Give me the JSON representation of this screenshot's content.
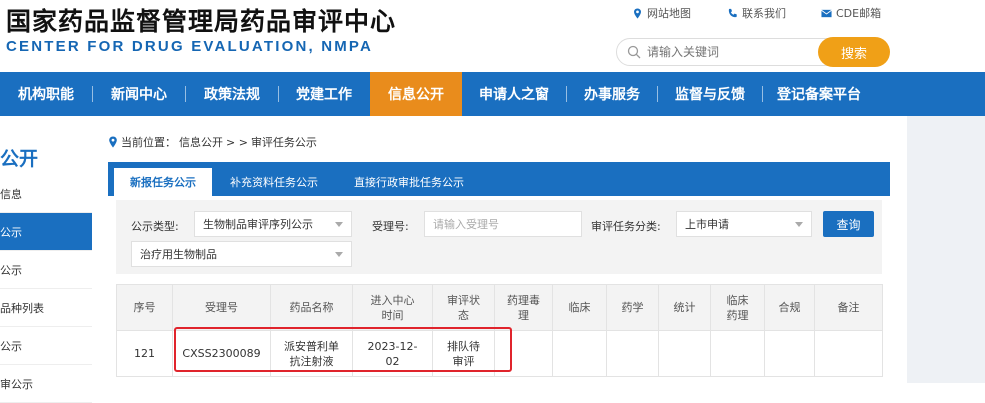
{
  "header": {
    "title_cn": "国家药品监督管理局药品审评中心",
    "title_en": "CENTER FOR DRUG EVALUATION, NMPA",
    "toplinks": [
      {
        "icon": "map-pin-icon",
        "label": "网站地图"
      },
      {
        "icon": "phone-icon",
        "label": "联系我们"
      },
      {
        "icon": "mail-icon",
        "label": "CDE邮箱"
      }
    ],
    "search_placeholder": "请输入关键词",
    "search_button": "搜索"
  },
  "nav": {
    "items": [
      "机构职能",
      "新闻中心",
      "政策法规",
      "党建工作",
      "信息公开",
      "申请人之窗",
      "办事服务",
      "监督与反馈",
      "登记备案平台"
    ],
    "active": "信息公开"
  },
  "sidebar": {
    "title": "公开",
    "items": [
      "信息",
      "公示",
      "公示",
      "品种列表",
      "公示",
      "审公示"
    ]
  },
  "breadcrumb": {
    "prefix": "当前位置：",
    "path1": "信息公开",
    "sep": "> >",
    "path2": "审评任务公示"
  },
  "tabs": [
    "新报任务公示",
    "补充资料任务公示",
    "直接行政审批任务公示"
  ],
  "filters": {
    "type_label": "公示类型:",
    "type_value": "生物制品审评序列公示",
    "accept_label": "受理号:",
    "accept_placeholder": "请输入受理号",
    "category_label": "审评任务分类:",
    "category_value": "上市申请",
    "query_button": "查询",
    "sub_value": "治疗用生物制品"
  },
  "table": {
    "headers": [
      [
        "序号"
      ],
      [
        "受理号"
      ],
      [
        "药品名称"
      ],
      [
        "进入中心",
        "时间"
      ],
      [
        "审评状",
        "态"
      ],
      [
        "药理毒",
        "理"
      ],
      [
        "临床"
      ],
      [
        "药学"
      ],
      [
        "统计"
      ],
      [
        "临床",
        "药理"
      ],
      [
        "合规"
      ],
      [
        "备注"
      ]
    ],
    "rows": [
      [
        "121",
        "CXSS2300089",
        "派安普利单|抗注射液",
        "2023-12-|02",
        "排队待|审评",
        "",
        "",
        "",
        "",
        "",
        "",
        ""
      ]
    ]
  },
  "colors": {
    "brand_blue": "#1a6fc0",
    "active_orange": "#e98c1c",
    "search_orange": "#f0a017",
    "highlight_red": "#e0242c"
  }
}
